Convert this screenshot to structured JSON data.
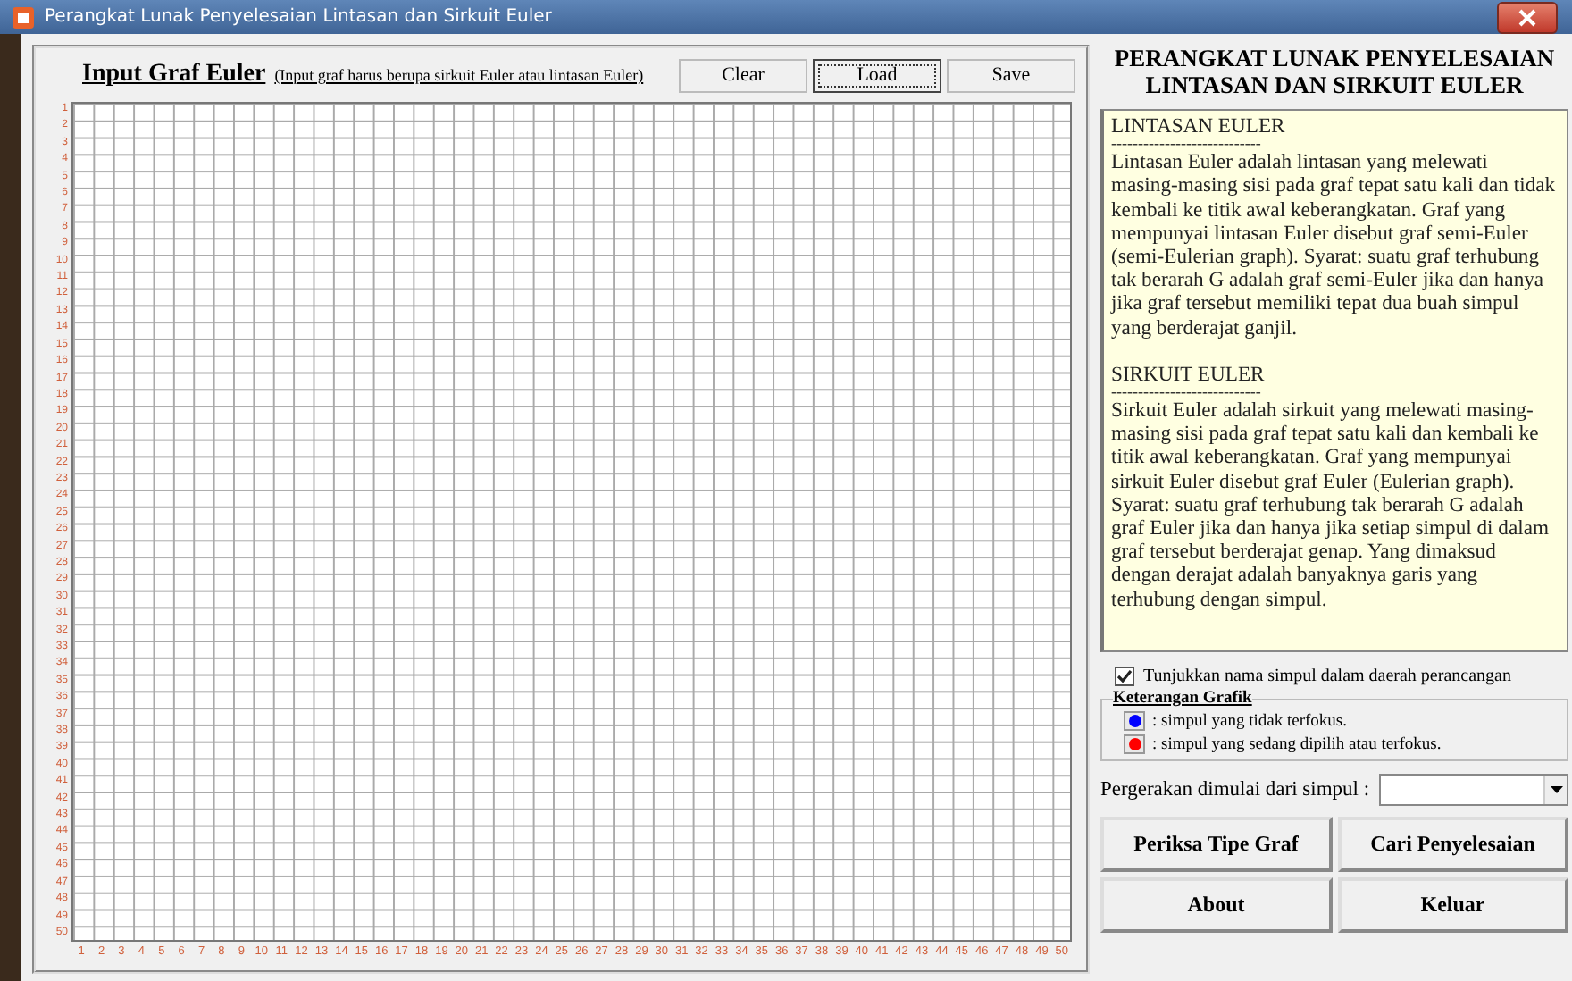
{
  "window": {
    "title": "Perangkat Lunak Penyelesaian Lintasan dan Sirkuit Euler"
  },
  "editor": {
    "title": "Input Graf Euler",
    "note": "(Input graf harus berupa sirkuit Euler atau lintasan Euler)",
    "buttons": [
      {
        "label": "Clear",
        "focused": false
      },
      {
        "label": "Load",
        "focused": true
      },
      {
        "label": "Save",
        "focused": false
      }
    ],
    "row_labels": [
      "1",
      "2",
      "3",
      "4",
      "5",
      "6",
      "7",
      "8",
      "9",
      "10",
      "11",
      "12",
      "13",
      "14",
      "15",
      "16",
      "17",
      "18",
      "19",
      "20",
      "21",
      "22",
      "23",
      "24",
      "25",
      "26",
      "27",
      "28",
      "29",
      "30",
      "31",
      "32",
      "33",
      "34",
      "35",
      "36",
      "37",
      "38",
      "39",
      "40",
      "41",
      "42",
      "43",
      "44",
      "45",
      "46",
      "47",
      "48",
      "49",
      "50"
    ],
    "column_labels": [
      "1",
      "2",
      "3",
      "4",
      "5",
      "6",
      "7",
      "8",
      "9",
      "10",
      "11",
      "12",
      "13",
      "14",
      "15",
      "16",
      "17",
      "18",
      "19",
      "20",
      "21",
      "22",
      "23",
      "24",
      "25",
      "26",
      "27",
      "28",
      "29",
      "30",
      "31",
      "32",
      "33",
      "34",
      "35",
      "36",
      "37",
      "38",
      "39",
      "40",
      "41",
      "42",
      "43",
      "44",
      "45",
      "46",
      "47",
      "48",
      "49",
      "50"
    ]
  },
  "info": {
    "heading": "PERANGKAT LUNAK PENYELESAIAN LINTASAN DAN SIRKUIT EULER",
    "sections": [
      {
        "title": "LINTASAN EULER",
        "rule": "----------------------------",
        "body": "Lintasan Euler adalah lintasan yang melewati masing-masing sisi pada graf tepat satu kali dan tidak kembali ke titik awal keberangkatan. Graf yang mempunyai lintasan Euler disebut graf semi-Euler (semi-Eulerian graph). Syarat: suatu graf terhubung tak berarah G adalah graf semi-Euler jika dan hanya jika graf tersebut memiliki tepat dua buah simpul yang berderajat ganjil."
      },
      {
        "title": "SIRKUIT EULER",
        "rule": "----------------------------",
        "body": "Sirkuit Euler adalah sirkuit yang melewati masing-masing sisi pada graf tepat satu kali dan kembali ke titik awal keberangkatan. Graf yang mempunyai sirkuit Euler disebut graf Euler (Eulerian graph). Syarat: suatu graf terhubung tak berarah G adalah graf Euler jika dan hanya jika setiap simpul di dalam graf tersebut berderajat genap. Yang dimaksud dengan derajat adalah banyaknya garis yang terhubung dengan simpul."
      }
    ]
  },
  "show_names": {
    "label": "Tunjukkan nama simpul dalam daerah perancangan",
    "checked": true
  },
  "legend": {
    "title": "Keterangan Grafik",
    "items": [
      {
        "color": "#0000ff",
        "label": ": simpul yang tidak terfokus."
      },
      {
        "color": "#ff0000",
        "label": ": simpul yang sedang dipilih atau terfokus."
      }
    ]
  },
  "start": {
    "label": "Pergerakan dimulai dari simpul :"
  },
  "actions": [
    "Periksa Tipe Graf",
    "Cari Penyelesaian",
    "About",
    "Keluar"
  ]
}
